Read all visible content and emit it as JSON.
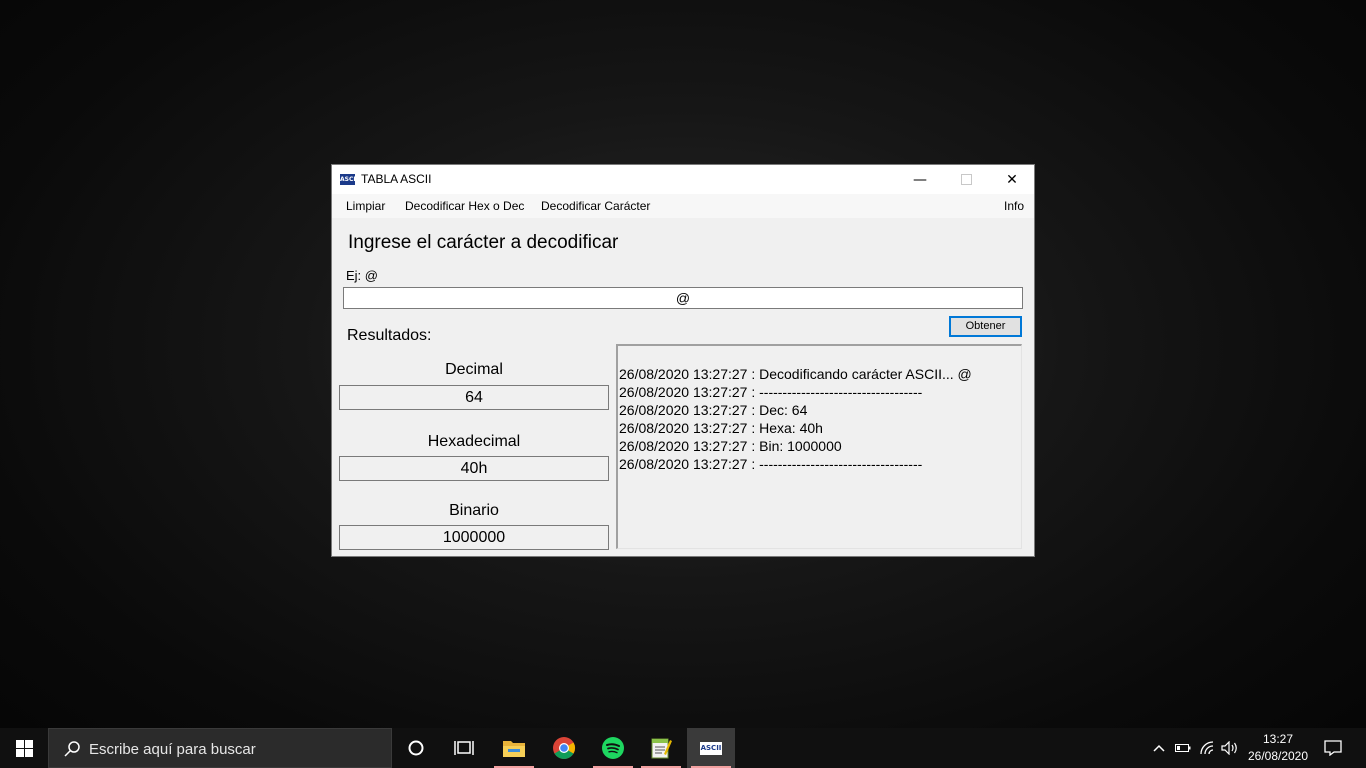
{
  "window": {
    "title": "TABLA ASCII",
    "icon_text": "ASCII",
    "menu": [
      "Limpiar",
      "Decodificar Hex o Dec",
      "Decodificar Carácter",
      "Info"
    ]
  },
  "form": {
    "heading": "Ingrese el carácter a decodificar",
    "hint": "Ej: @",
    "input_value": "@",
    "button_label": "Obtener",
    "results_label": "Resultados:",
    "decimal_label": "Decimal",
    "decimal_value": "64",
    "hex_label": "Hexadecimal",
    "hex_value": "40h",
    "bin_label": "Binario",
    "bin_value": "1000000"
  },
  "log": [
    "26/08/2020 13:27:27 : Decodificando carácter ASCII... @",
    "26/08/2020 13:27:27 : -----------------------------------",
    "26/08/2020 13:27:27 : Dec: 64",
    "26/08/2020 13:27:27 : Hexa: 40h",
    "26/08/2020 13:27:27 : Bin: 1000000",
    "26/08/2020 13:27:27 : -----------------------------------"
  ],
  "taskbar": {
    "search_placeholder": "Escribe aquí para buscar",
    "apps": [
      "cortana-icon",
      "task-view-icon",
      "file-explorer-icon",
      "chrome-icon",
      "spotify-icon",
      "notepad-icon",
      "ascii-app-icon"
    ],
    "ascii_icon_text": "ASCII",
    "time": "13:27",
    "date": "26/08/2020"
  }
}
